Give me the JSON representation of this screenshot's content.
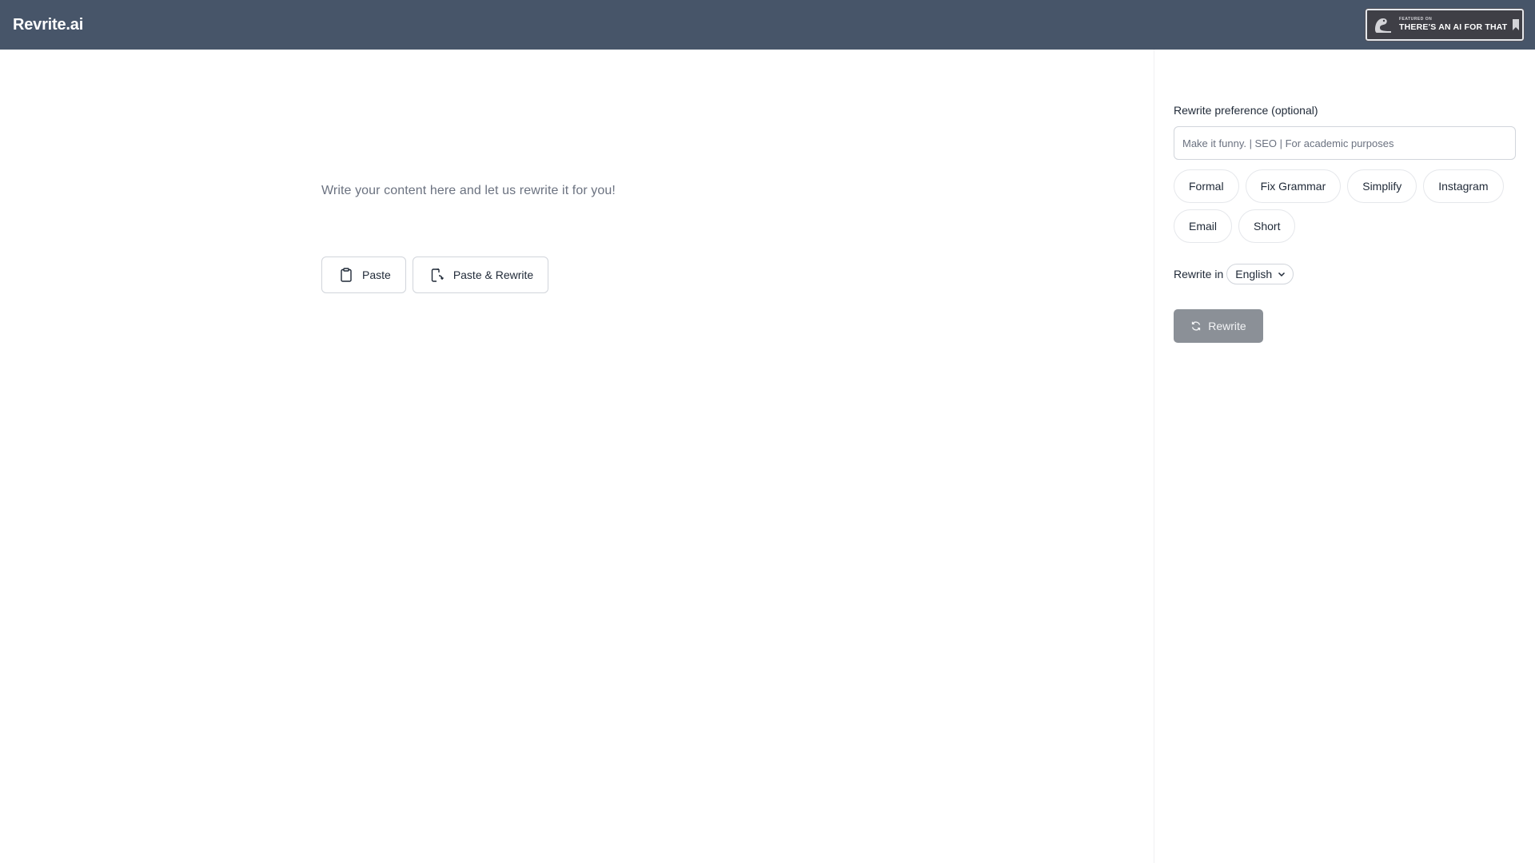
{
  "header": {
    "brand": "Revrite.ai",
    "badge": {
      "small_text": "FEATURED ON",
      "big_text": "THERE'S AN AI FOR THAT",
      "icon": "taaft-logo-icon",
      "bookmark_icon": "bookmark-icon"
    },
    "background_color": "#475569"
  },
  "editor": {
    "placeholder": "Write your content here and let us rewrite it for you!",
    "paste_button": {
      "label": "Paste",
      "icon": "clipboard-icon"
    },
    "paste_rewrite_button": {
      "label": "Paste & Rewrite",
      "icon": "paste-rewrite-icon"
    }
  },
  "panel": {
    "preference_label": "Rewrite preference (optional)",
    "preference_placeholder": "Make it funny. | SEO | For academic purposes",
    "preference_value": "",
    "chips": [
      "Formal",
      "Fix Grammar",
      "Simplify",
      "Instagram",
      "Email",
      "Short"
    ],
    "language_label": "Rewrite in",
    "language_selected": "English",
    "rewrite_button": {
      "label": "Rewrite",
      "icon": "refresh-icon",
      "color": "#8b9097"
    }
  }
}
